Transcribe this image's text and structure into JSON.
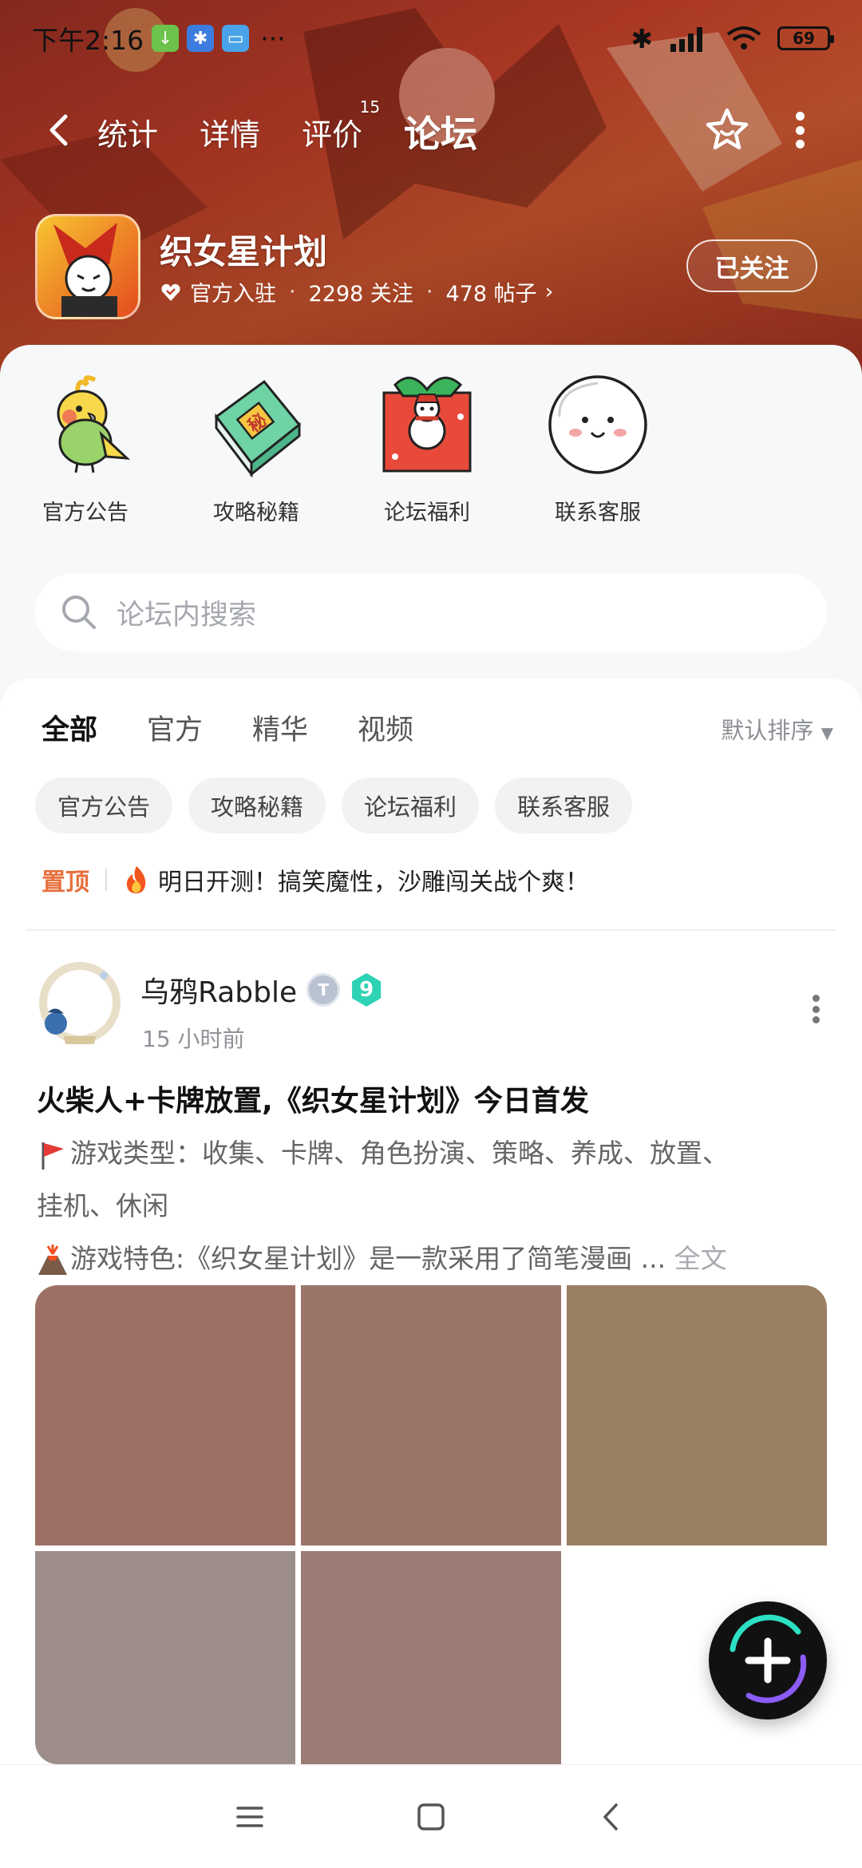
{
  "status_bar": {
    "time": "下午2:16",
    "battery": "69"
  },
  "top_nav": {
    "tabs": [
      {
        "label": "统计"
      },
      {
        "label": "详情"
      },
      {
        "label": "评价",
        "badge": "15"
      },
      {
        "label": "论坛",
        "active": true
      }
    ]
  },
  "game": {
    "title": "织女星计划",
    "official": "官方入驻",
    "followers": "2298 关注",
    "posts": "478 帖子",
    "follow_button": "已关注"
  },
  "quick_entries": [
    {
      "label": "官方公告",
      "icon": "parrot-icon"
    },
    {
      "label": "攻略秘籍",
      "icon": "secret-book-icon"
    },
    {
      "label": "论坛福利",
      "icon": "gift-box-icon"
    },
    {
      "label": "联系客服",
      "icon": "customer-service-icon"
    }
  ],
  "search": {
    "placeholder": "论坛内搜索"
  },
  "feed": {
    "tabs": [
      "全部",
      "官方",
      "精华",
      "视频"
    ],
    "active_tab": "全部",
    "sort": "默认排序",
    "chips": [
      "官方公告",
      "攻略秘籍",
      "论坛福利",
      "联系客服"
    ],
    "pinned": {
      "tag": "置顶",
      "text": "明日开测！搞笑魔性，沙雕闯关战个爽！"
    }
  },
  "post": {
    "author": "乌鸦Rabble",
    "level": "9",
    "time": "15 小时前",
    "title": "火柴人+卡牌放置,《织女星计划》今日首发",
    "line1": "游戏类型：收集、卡牌、角色扮演、策略、养成、放置、",
    "line2": "挂机、休闲",
    "line3": "游戏特色:《织女星计划》是一款采用了简笔漫画 ...",
    "full_text": "全文",
    "images": [
      {
        "color": "#9e7065"
      },
      {
        "color": "#9a7569"
      },
      {
        "color": "#9a8062"
      },
      {
        "color": "#9d8e8b"
      },
      {
        "color": "#9a7b76"
      }
    ]
  },
  "colors": {
    "accent": "#2de0c4",
    "pinned": "#e7703d"
  }
}
